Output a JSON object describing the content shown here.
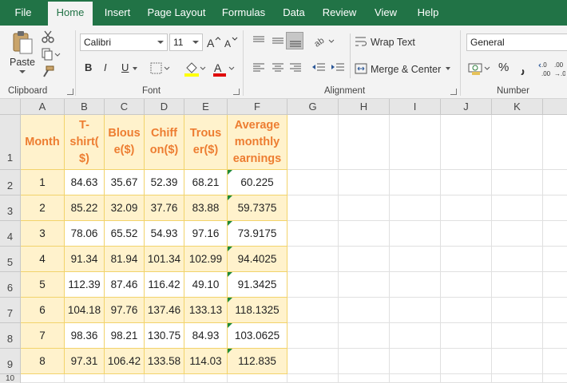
{
  "tabs": [
    "File",
    "Home",
    "Insert",
    "Page Layout",
    "Formulas",
    "Data",
    "Review",
    "View",
    "Help"
  ],
  "active_tab": "Home",
  "ribbon": {
    "clipboard": {
      "paste_label": "Paste",
      "group_label": "Clipboard"
    },
    "font": {
      "name": "Calibri",
      "size": "11",
      "group_label": "Font",
      "bold": "B",
      "italic": "I",
      "underline": "U"
    },
    "alignment": {
      "wrap_text": "Wrap Text",
      "merge_center": "Merge & Center",
      "group_label": "Alignment"
    },
    "number": {
      "format": "General",
      "percent": "%",
      "group_label": "Number"
    }
  },
  "colors": {
    "accent": "#217346",
    "header_text": "#ed7d31",
    "fill_yellow": "#fff2cc",
    "error_triangle": "#1d8a3a"
  },
  "columns": [
    "A",
    "B",
    "C",
    "D",
    "E",
    "F",
    "G",
    "H",
    "I",
    "J",
    "K"
  ],
  "rows": [
    "1",
    "2",
    "3",
    "4",
    "5",
    "6",
    "7",
    "8",
    "9",
    "10"
  ],
  "table": {
    "headers": [
      "Month",
      "T-shirt($)",
      "Blouse($)",
      "Chiffon($)",
      "Trouser($)",
      "Average monthly earnings"
    ],
    "header_lines": [
      [
        "Month"
      ],
      [
        "T-",
        "shirt(",
        "$)"
      ],
      [
        "Blous",
        "e($)"
      ],
      [
        "Chiff",
        "on($)"
      ],
      [
        "Trous",
        "er($)"
      ],
      [
        "Average",
        "monthly",
        "earnings"
      ]
    ],
    "data": [
      [
        "1",
        "84.63",
        "35.67",
        "52.39",
        "68.21",
        "60.225"
      ],
      [
        "2",
        "85.22",
        "32.09",
        "37.76",
        "83.88",
        "59.7375"
      ],
      [
        "3",
        "78.06",
        "65.52",
        "54.93",
        "97.16",
        "73.9175"
      ],
      [
        "4",
        "91.34",
        "81.94",
        "101.34",
        "102.99",
        "94.4025"
      ],
      [
        "5",
        "112.39",
        "87.46",
        "116.42",
        "49.10",
        "91.3425"
      ],
      [
        "6",
        "104.18",
        "97.76",
        "137.46",
        "133.13",
        "118.1325"
      ],
      [
        "7",
        "98.36",
        "98.21",
        "130.75",
        "84.93",
        "103.0625"
      ],
      [
        "8",
        "97.31",
        "106.42",
        "133.58",
        "114.03",
        "112.835"
      ]
    ]
  }
}
